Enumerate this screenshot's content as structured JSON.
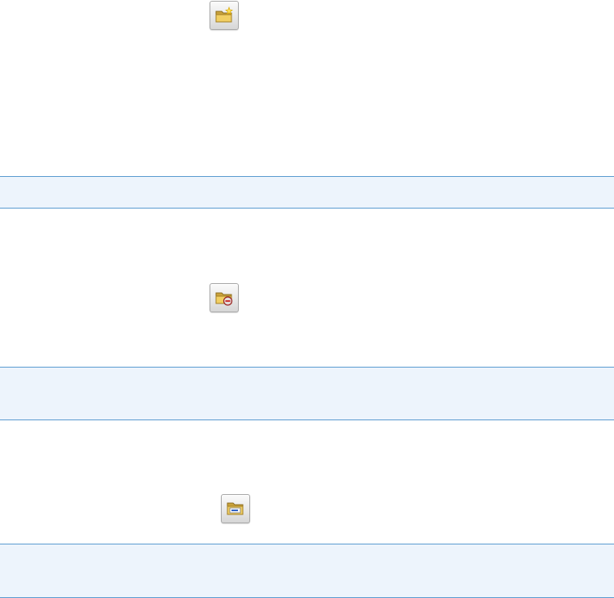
{
  "buttons": {
    "new_folder": {
      "icon": "new-folder-icon"
    },
    "remove_folder": {
      "icon": "remove-folder-icon"
    },
    "folder_properties": {
      "icon": "folder-card-icon"
    }
  },
  "colors": {
    "band_fill": "#edf4fc",
    "band_border": "#5a9bd0",
    "folder_yellow": "#e9c45a",
    "remove_badge": "#d43a3a",
    "card_blue": "#2f63c8"
  }
}
